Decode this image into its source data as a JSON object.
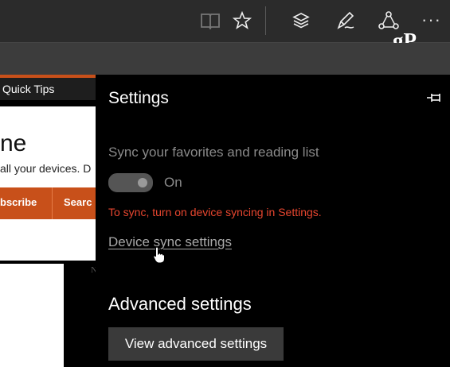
{
  "toolbar": {
    "icons": [
      "reading-view-icon",
      "favorite-star-icon",
      "hub-icon",
      "web-note-icon",
      "share-icon",
      "more-icon"
    ],
    "more_label": "···",
    "brand": "gP"
  },
  "page": {
    "tab_label": "Quick Tips",
    "heading_fragment": "ne",
    "body_fragment": "all your devices. D",
    "subscribe_label": "bscribe",
    "search_label": "Searc",
    "fragment_n": "N"
  },
  "settings": {
    "title": "Settings",
    "sync_label": "Sync your favorites and reading list",
    "toggle_state": "On",
    "warning": "To sync, turn on device syncing in Settings.",
    "device_sync_link": "Device sync settings",
    "advanced_heading": "Advanced settings",
    "advanced_button": "View advanced settings"
  },
  "colors": {
    "accent_orange": "#c8501a",
    "warning_red": "#e8462f"
  }
}
